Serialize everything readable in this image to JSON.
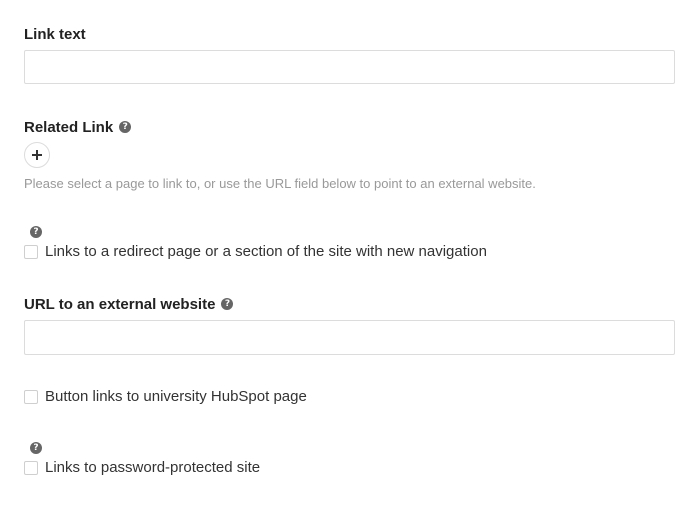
{
  "form": {
    "link_text": {
      "label": "Link text",
      "value": "",
      "placeholder": ""
    },
    "related_link": {
      "label": "Related Link",
      "help_icon": "question-circle-icon",
      "add_icon": "plus-icon",
      "help_text": "Please select a page to link to, or use the URL field below to point to an external website."
    },
    "redirect_checkbox": {
      "help_icon": "question-circle-icon",
      "label": "Links to a redirect page or a section of the site with new navigation",
      "checked": false
    },
    "external_url": {
      "label": "URL to an external website",
      "help_icon": "question-circle-icon",
      "value": "",
      "placeholder": ""
    },
    "hubspot_checkbox": {
      "label": "Button links to university HubSpot page",
      "checked": false
    },
    "password_checkbox": {
      "help_icon": "question-circle-icon",
      "label": "Links to password-protected site",
      "checked": false
    }
  },
  "help_glyph": "?",
  "colors": {
    "label": "#222222",
    "body_text": "#333333",
    "help_text": "#999999",
    "border": "#dcdcdc",
    "icon": "#666666"
  }
}
